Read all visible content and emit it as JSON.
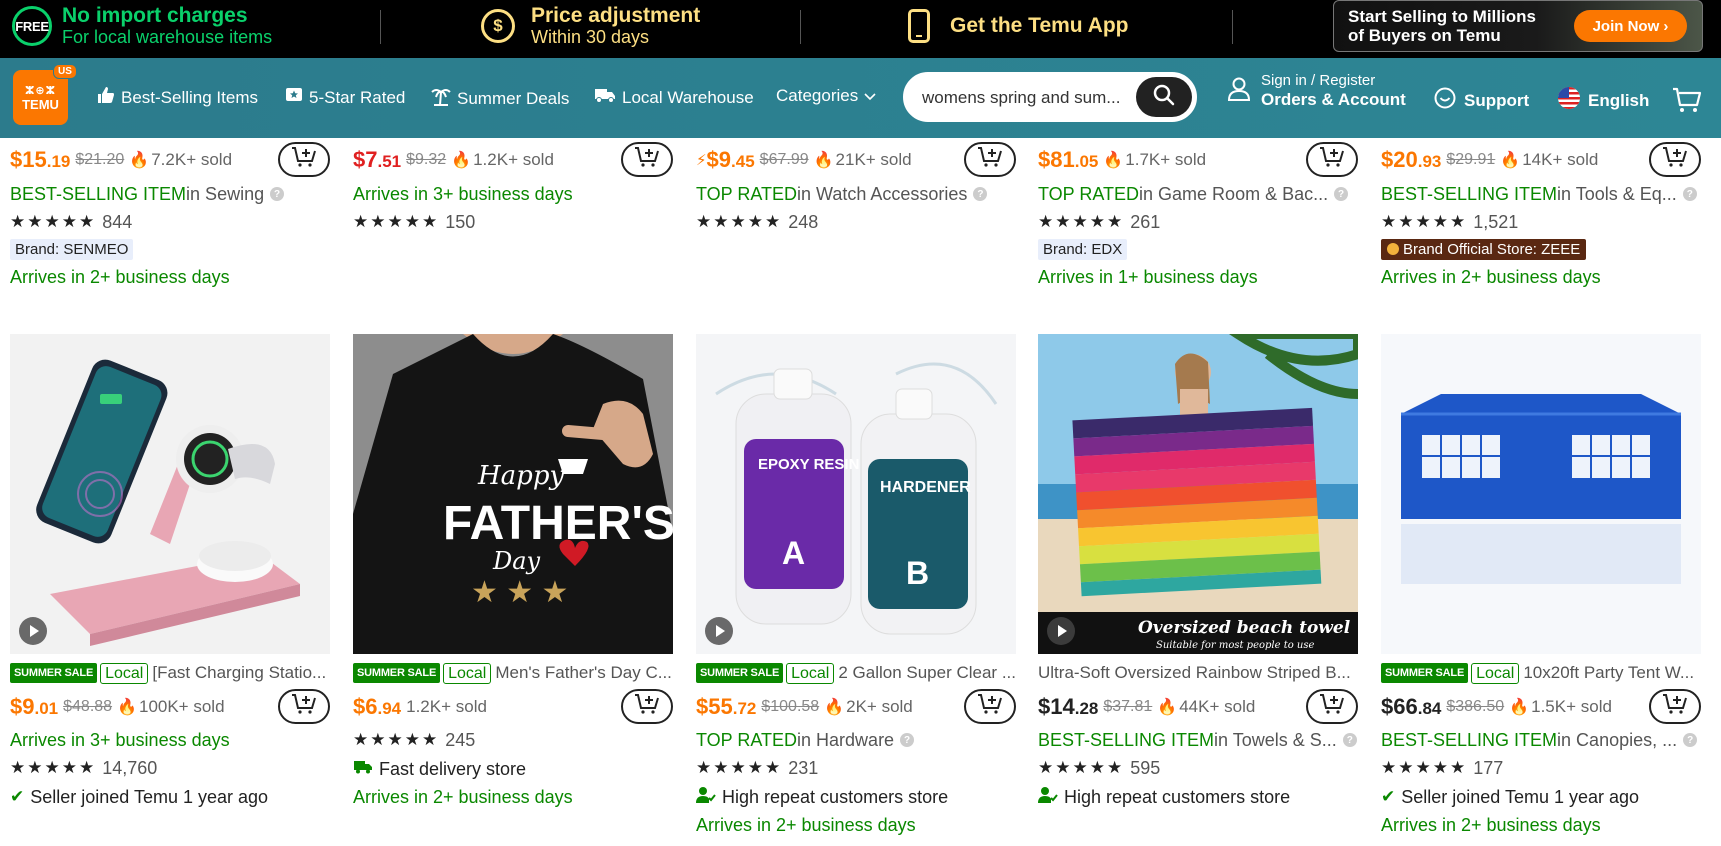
{
  "promo": {
    "free_badge": "FREE",
    "import_title": "No import charges",
    "import_sub": "For local warehouse items",
    "price_icon": "$",
    "price_title": "Price adjustment",
    "price_sub": "Within 30 days",
    "app_title": "Get the Temu App",
    "sell_line1": "Start Selling to Millions",
    "sell_line2": "of Buyers on Temu",
    "join_label": "Join Now ›"
  },
  "header": {
    "logo_line1": "ⵣ⊕ⵣ",
    "logo_line2": "TEMU",
    "region": "US",
    "nav": [
      "Best-Selling Items",
      "5-Star Rated",
      "Summer Deals",
      "Local Warehouse",
      "Categories"
    ],
    "search_value": "womens spring and sum...",
    "account_line1": "Sign in / Register",
    "account_line2": "Orders & Account",
    "support": "Support",
    "language": "English"
  },
  "top_row": [
    {
      "price_int": "$15",
      "price_dec": ".19",
      "orig": "$21.20",
      "sold": "7.2K+ sold",
      "rank_label": "BEST-SELLING ITEM",
      "rank_cat": " in Sewing",
      "stars": "★★★★★",
      "reviews": "844",
      "brand": "Brand: SENMEO",
      "arrival": "Arrives in 2+ business days"
    },
    {
      "price_int": "$7",
      "price_dec": ".51",
      "orig": "$9.32",
      "sold": "1.2K+ sold",
      "delivery": "Arrives in 3+ business days",
      "stars": "★★★★★",
      "reviews": "150"
    },
    {
      "lightning": "⚡",
      "price_int": "$9",
      "price_dec": ".45",
      "orig": "$67.99",
      "sold": "21K+ sold",
      "rank_label": "TOP RATED",
      "rank_cat": " in Watch Accessories",
      "stars": "★★★★★",
      "reviews": "248"
    },
    {
      "price_int": "$81",
      "price_dec": ".05",
      "sold": "1.7K+ sold",
      "rank_label": "TOP RATED",
      "rank_cat": " in Game Room & Bac...",
      "stars": "★★★★★",
      "reviews": "261",
      "brand": "Brand: EDX",
      "arrival": "Arrives in 1+ business days"
    },
    {
      "price_int": "$20",
      "price_dec": ".93",
      "orig": "$29.91",
      "sold": "14K+ sold",
      "rank_label": "BEST-SELLING ITEM",
      "rank_cat": " in Tools & Eq...",
      "stars": "★★★★★",
      "reviews": "1,521",
      "brand": "Brand Official Store: ZEEE",
      "arrival": "Arrives in 2+ business days"
    }
  ],
  "bottom_row": [
    {
      "sale_tag": "SUMMER SALE",
      "local_tag": "Local",
      "title": "[Fast Charging Statio...",
      "price_int": "$9",
      "price_dec": ".01",
      "orig": "$48.88",
      "sold": "100K+ sold",
      "delivery": "Arrives in 3+ business days",
      "stars": "★★★★★",
      "reviews": "14,760",
      "store": "Seller joined Temu 1 year ago"
    },
    {
      "sale_tag": "SUMMER SALE",
      "local_tag": "Local",
      "title": "Men's Father's Day C...",
      "price_int": "$6",
      "price_dec": ".94",
      "sold": "1.2K+ sold",
      "stars": "★★★★★",
      "reviews": "245",
      "store": "Fast delivery store",
      "arrival": "Arrives in 2+ business days",
      "shirt_line1": "Happy",
      "shirt_line2": "FATHER'S",
      "shirt_line3": "Day"
    },
    {
      "sale_tag": "SUMMER SALE",
      "local_tag": "Local",
      "title": "2 Gallon Super Clear ...",
      "price_int": "$55",
      "price_dec": ".72",
      "orig": "$100.58",
      "sold": "2K+ sold",
      "rank_label": "TOP RATED",
      "rank_cat": " in Hardware",
      "stars": "★★★★★",
      "reviews": "231",
      "store": "High repeat customers store",
      "arrival": "Arrives in 2+ business days",
      "bottle_a": "EPOXY RESIN",
      "bottle_a_letter": "A",
      "bottle_b": "HARDENER",
      "bottle_b_letter": "B"
    },
    {
      "title": "Ultra-Soft Oversized Rainbow Striped B...",
      "price_int": "$14",
      "price_dec": ".28",
      "orig": "$37.81",
      "sold": "44K+ sold",
      "rank_label": "BEST-SELLING ITEM",
      "rank_cat": " in Towels & S...",
      "stars": "★★★★★",
      "reviews": "595",
      "store": "High repeat customers store",
      "banner_title": "Oversized beach towel",
      "banner_sub": "Suitable for most people to use"
    },
    {
      "sale_tag": "SUMMER SALE",
      "local_tag": "Local",
      "title": "10x20ft Party Tent W...",
      "price_int": "$66",
      "price_dec": ".84",
      "orig": "$386.50",
      "sold": "1.5K+ sold",
      "rank_label": "BEST-SELLING ITEM",
      "rank_cat": " in Canopies, ...",
      "stars": "★★★★★",
      "reviews": "177",
      "store": "Seller joined Temu 1 year ago",
      "arrival": "Arrives in 2+ business days"
    }
  ],
  "colors": {
    "accent": "#fb7701",
    "header_teal": "#2c7b8c",
    "green": "#0a8800",
    "promo_green": "#0ad16b",
    "promo_yellow": "#fddf83"
  },
  "icons": [
    "free-icon",
    "price-adjust-icon",
    "phone-icon",
    "thumbs-up-icon",
    "star-badge-icon",
    "palm-tree-icon",
    "truck-icon",
    "chevron-down-icon",
    "search-icon",
    "user-icon",
    "support-chat-icon",
    "us-flag-icon",
    "cart-icon",
    "add-to-cart-icon",
    "flame-icon",
    "help-icon",
    "play-icon",
    "truck-store-icon",
    "repeat-customer-icon",
    "calendar-check-icon"
  ]
}
